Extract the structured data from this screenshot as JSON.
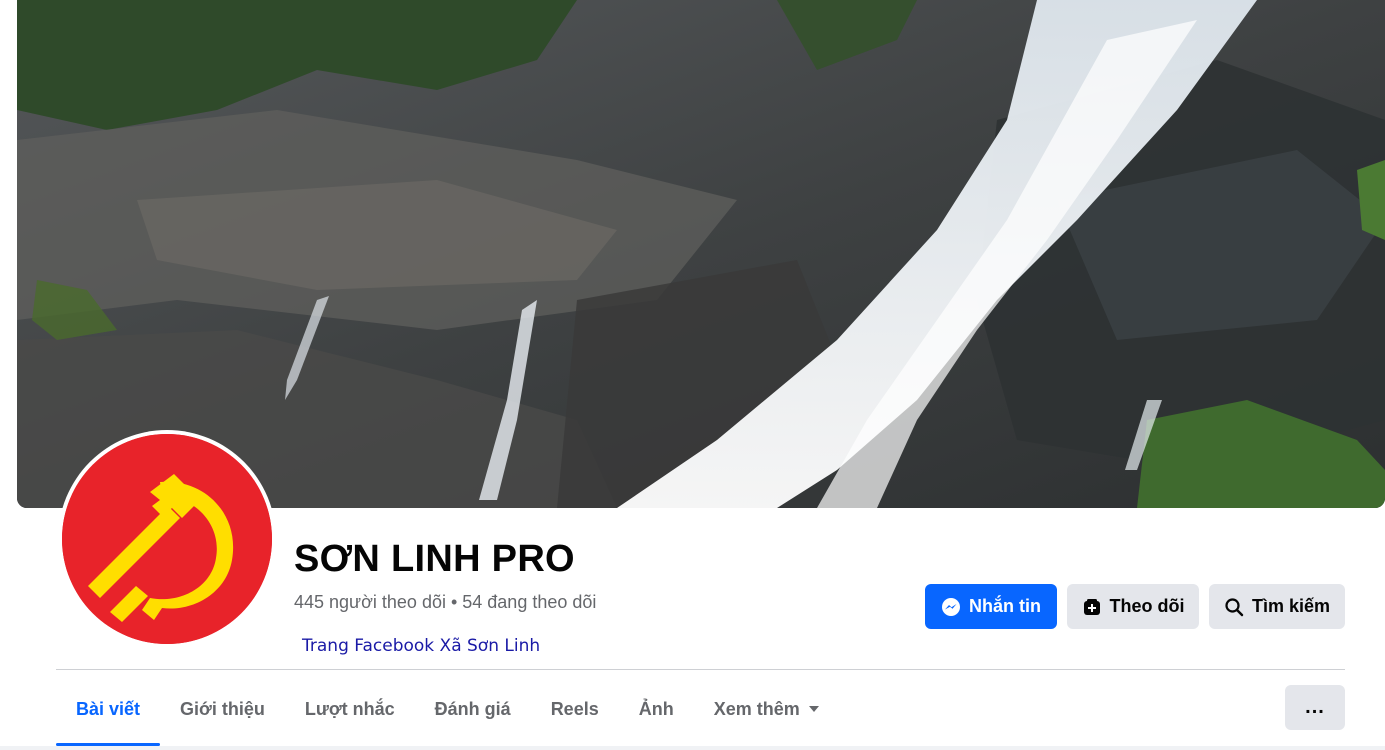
{
  "profile": {
    "name": "SƠN LINH PRO",
    "stats": "445 người theo dõi • 54 đang theo dõi",
    "intro_link": "Trang Facebook Xã Sơn Linh"
  },
  "actions": {
    "message_label": "Nhắn tin",
    "follow_label": "Theo dõi",
    "search_label": "Tìm kiếm",
    "more_label": "..."
  },
  "tabs": [
    {
      "label": "Bài viết"
    },
    {
      "label": "Giới thiệu"
    },
    {
      "label": "Lượt nhắc"
    },
    {
      "label": "Đánh giá"
    },
    {
      "label": "Reels"
    },
    {
      "label": "Ảnh"
    },
    {
      "label": "Xem thêm"
    }
  ],
  "active_tab": "Bài viết",
  "colors": {
    "accent": "#0866ff",
    "button_gray": "#e4e6eb",
    "secondary_text": "#65676b",
    "avatar_red": "#e8232a",
    "emblem_yellow": "#ffde00"
  }
}
